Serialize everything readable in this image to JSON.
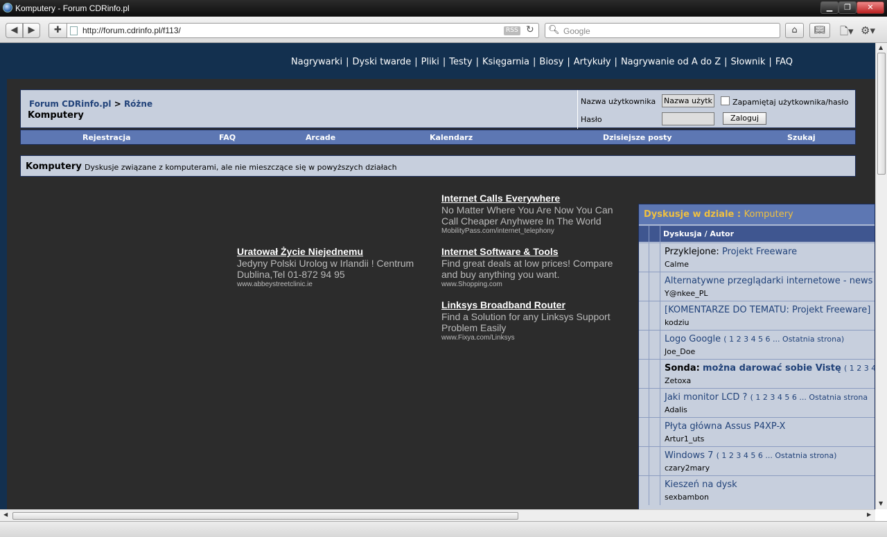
{
  "window": {
    "title": "Komputery - Forum CDRinfo.pl"
  },
  "toolbar": {
    "url": "http://forum.cdrinfo.pl/f113/",
    "rss_label": "RSS",
    "search_placeholder": "Google"
  },
  "site_nav": [
    "Nagrywarki",
    "Dyski twarde",
    "Pliki",
    "Testy",
    "Księgarnia",
    "Biosy",
    "Artykuły",
    "Nagrywanie od A do Z",
    "Słownik",
    "FAQ"
  ],
  "breadcrumb": {
    "root": "Forum CDRinfo.pl",
    "sep": ">",
    "parent": "Różne",
    "current": "Komputery"
  },
  "login": {
    "username_label": "Nazwa użytkownika",
    "username_value": "Nazwa użytk",
    "remember_label": "Zapamiętaj użytkownika/hasło",
    "password_label": "Hasło",
    "submit_label": "Zaloguj"
  },
  "menu": [
    "Rejestracja",
    "FAQ",
    "Arcade",
    "Kalendarz",
    "Dzisiejsze posty",
    "Szukaj"
  ],
  "forum_desc": {
    "title": "Komputery",
    "text": "Dyskusje związane z komputerami, ale nie mieszczące się w powyższych działach"
  },
  "ads": [
    {
      "title": "Uratował Życie Niejednemu",
      "body": "Jedyny Polski Urolog w Irlandii ! Centrum Dublina,Tel 01-872 94 95",
      "url": "www.abbeystreetclinic.ie"
    },
    {
      "title": "Internet Calls Everywhere",
      "body": "No Matter Where You Are Now You Can Call Cheaper Anyhwere In The World",
      "url": "MobilityPass.com/internet_telephony"
    },
    {
      "title": "Internet Software & Tools",
      "body": "Find great deals at low prices! Compare and buy anything you want.",
      "url": "www.Shopping.com"
    },
    {
      "title": "Linksys Broadband Router",
      "body": "Find a Solution for any Linksys Support Problem Easily",
      "url": "www.Fixya.com/Linksys"
    }
  ],
  "topics": {
    "header_prefix": "Dyskusje w dziale",
    "header_sep": ":",
    "header_category": "Komputery",
    "column_label": "Dyskusja / Autor",
    "rows": [
      {
        "prefix": "Przyklejone:",
        "title": "Projekt Freeware",
        "pages": "",
        "author": "Calme"
      },
      {
        "prefix": "",
        "title": "Alternatywne przeglądarki internetowe - news",
        "pages": "",
        "author": "Y@nkee_PL"
      },
      {
        "prefix": "",
        "title": "[KOMENTARZE DO TEMATU: Projekt Freeware]",
        "pages": "",
        "author": "kodziu"
      },
      {
        "prefix": "",
        "title": "Logo Google",
        "pages": "( 1 2 3 4 5 6 ... Ostatnia strona)",
        "author": "Joe_Doe"
      },
      {
        "prefix": "Sonda:",
        "title": "można darować sobie Vistę",
        "pages": "( 1 2 3 4",
        "author": "Zetoxa"
      },
      {
        "prefix": "",
        "title": "Jaki monitor LCD ?",
        "pages": "( 1 2 3 4 5 6 ... Ostatnia strona",
        "author": "Adalis"
      },
      {
        "prefix": "",
        "title": "Płyta główna Assus P4XP-X",
        "pages": "",
        "author": "Artur1_uts"
      },
      {
        "prefix": "",
        "title": "Windows 7",
        "pages": "( 1 2 3 4 5 6 ... Ostatnia strona)",
        "author": "czary2mary"
      },
      {
        "prefix": "",
        "title": "Kieszeń na dysk",
        "pages": "",
        "author": "sexbambon"
      }
    ]
  },
  "colors": {
    "page_bg": "#13304f",
    "content_bg": "#2c2c2c",
    "panel": "#c7cfdd",
    "menu_bar": "#5d77b3",
    "link": "#22437a",
    "accent_yellow": "#f0c040"
  }
}
